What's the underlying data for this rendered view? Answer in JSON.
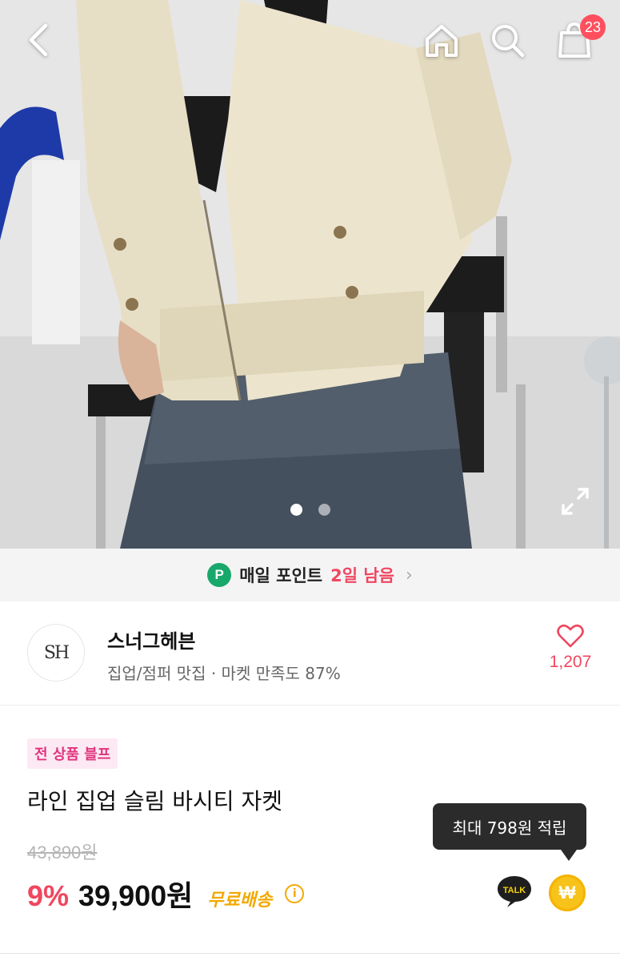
{
  "header": {
    "back_icon": "chevron-left-icon",
    "home_icon": "home-icon",
    "search_icon": "search-icon",
    "cart_icon": "shopping-bag-icon",
    "cart_count": "23"
  },
  "gallery": {
    "total_images": 2,
    "active_index": 0,
    "expand_icon": "expand-icon"
  },
  "points_banner": {
    "icon_letter": "P",
    "label": "매일 포인트",
    "remaining": "2일 남음",
    "chevron": "›"
  },
  "shop": {
    "logo_text": "SH",
    "name": "스너그헤븐",
    "subtitle": "집업/점퍼 맛집 · 마켓 만족도 87%",
    "favorite_count": "1,207"
  },
  "product": {
    "badge": "전 상품 블프",
    "title": "라인 집업 슬림 바시티 자켓",
    "original_price": "43,890원",
    "discount": "9%",
    "price": "39,900원",
    "shipping": "무료배송",
    "info_icon": "i"
  },
  "reward_tooltip": "최대 798원 적립",
  "talk_label": "TALK",
  "won_symbol": "₩",
  "colors": {
    "accent_pink": "#f0465f",
    "badge_bg": "#fde9f3",
    "shipping_yellow": "#f2a900",
    "points_green": "#19a86b"
  }
}
